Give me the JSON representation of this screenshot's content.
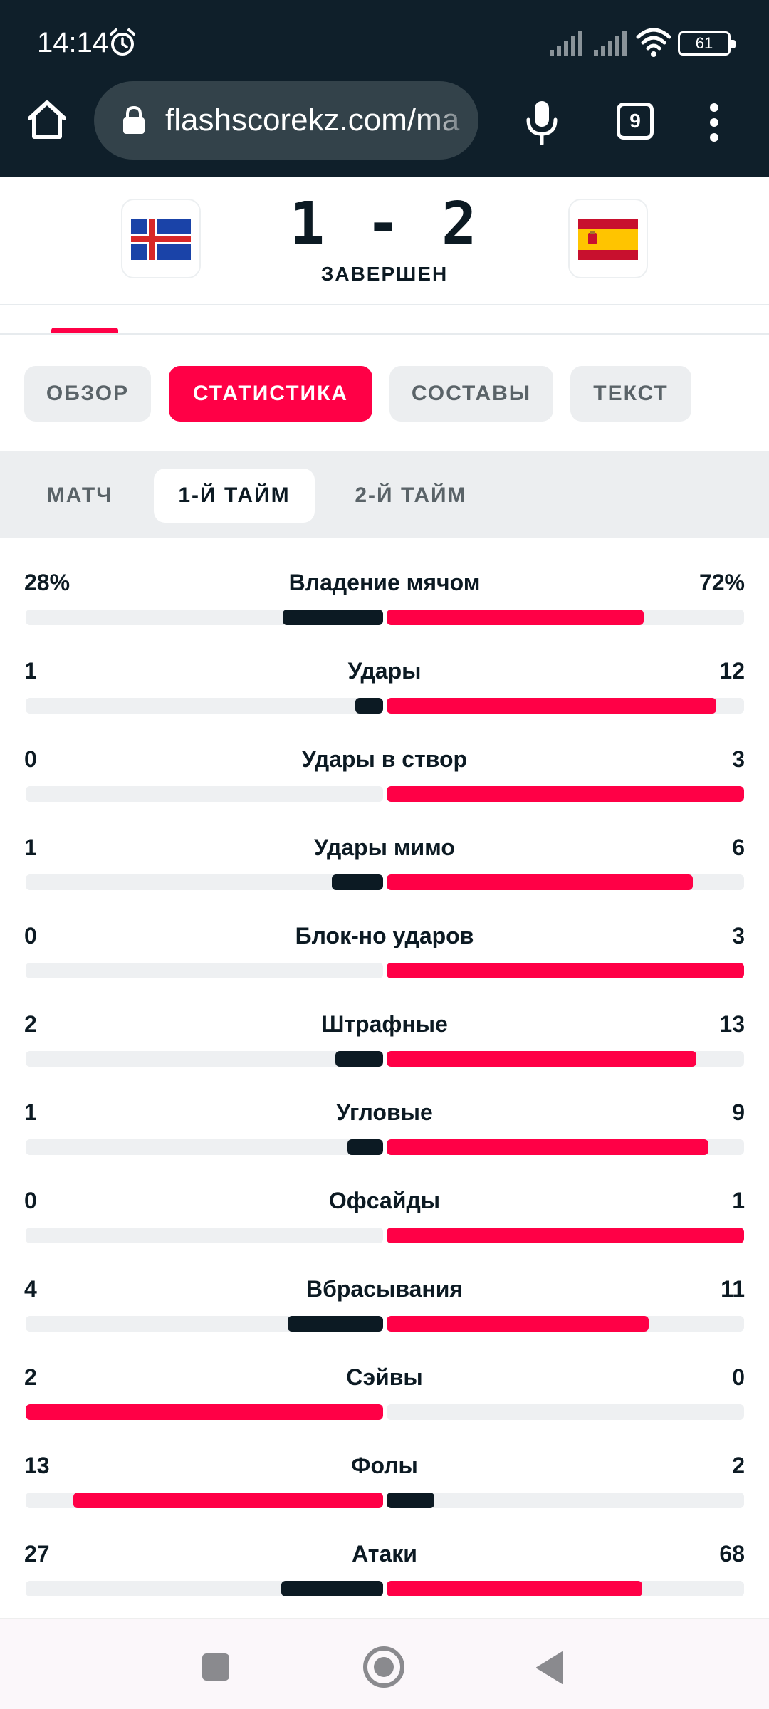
{
  "status_bar": {
    "time": "14:14",
    "battery": "61"
  },
  "browser": {
    "url": "flashscorekz.com/ma",
    "tab_count": "9"
  },
  "match": {
    "score": "1 - 2",
    "status": "ЗАВЕРШЕН",
    "home_team_flag": "iceland-flag",
    "away_team_flag": "spain-flag"
  },
  "main_tabs": [
    {
      "label": "ОБЗОР",
      "active": false
    },
    {
      "label": "СТАТИСТИКА",
      "active": true
    },
    {
      "label": "СОСТАВЫ",
      "active": false
    },
    {
      "label": "ТЕКСТ",
      "active": false
    }
  ],
  "sub_tabs": [
    {
      "label": "МАТЧ",
      "active": false
    },
    {
      "label": "1-Й ТАЙМ",
      "active": true
    },
    {
      "label": "2-Й ТАЙМ",
      "active": false
    }
  ],
  "colors": {
    "accent": "#ff0046",
    "dark": "#0c1a23",
    "track": "#eef0f2"
  },
  "stats": [
    {
      "name": "Владение мячом",
      "home": "28%",
      "away": "72%",
      "home_val": 28,
      "away_val": 72,
      "home_ratio": 0.28,
      "away_ratio": 0.72
    },
    {
      "name": "Удары",
      "home": "1",
      "away": "12",
      "home_val": 1,
      "away_val": 12,
      "home_ratio": 0.0769,
      "away_ratio": 0.9231
    },
    {
      "name": "Удары в створ",
      "home": "0",
      "away": "3",
      "home_val": 0,
      "away_val": 3,
      "home_ratio": 0,
      "away_ratio": 1
    },
    {
      "name": "Удары мимо",
      "home": "1",
      "away": "6",
      "home_val": 1,
      "away_val": 6,
      "home_ratio": 0.1429,
      "away_ratio": 0.8571
    },
    {
      "name": "Блок-но ударов",
      "home": "0",
      "away": "3",
      "home_val": 0,
      "away_val": 3,
      "home_ratio": 0,
      "away_ratio": 1
    },
    {
      "name": "Штрафные",
      "home": "2",
      "away": "13",
      "home_val": 2,
      "away_val": 13,
      "home_ratio": 0.1333,
      "away_ratio": 0.8667
    },
    {
      "name": "Угловые",
      "home": "1",
      "away": "9",
      "home_val": 1,
      "away_val": 9,
      "home_ratio": 0.1,
      "away_ratio": 0.9
    },
    {
      "name": "Офсайды",
      "home": "0",
      "away": "1",
      "home_val": 0,
      "away_val": 1,
      "home_ratio": 0,
      "away_ratio": 1
    },
    {
      "name": "Вбрасывания",
      "home": "4",
      "away": "11",
      "home_val": 4,
      "away_val": 11,
      "home_ratio": 0.2667,
      "away_ratio": 0.7333
    },
    {
      "name": "Сэйвы",
      "home": "2",
      "away": "0",
      "home_val": 2,
      "away_val": 0,
      "home_ratio": 1,
      "away_ratio": 0
    },
    {
      "name": "Фолы",
      "home": "13",
      "away": "2",
      "home_val": 13,
      "away_val": 2,
      "home_ratio": 0.8667,
      "away_ratio": 0.1333
    },
    {
      "name": "Атаки",
      "home": "27",
      "away": "68",
      "home_val": 27,
      "away_val": 68,
      "home_ratio": 0.2842,
      "away_ratio": 0.7158
    }
  ]
}
